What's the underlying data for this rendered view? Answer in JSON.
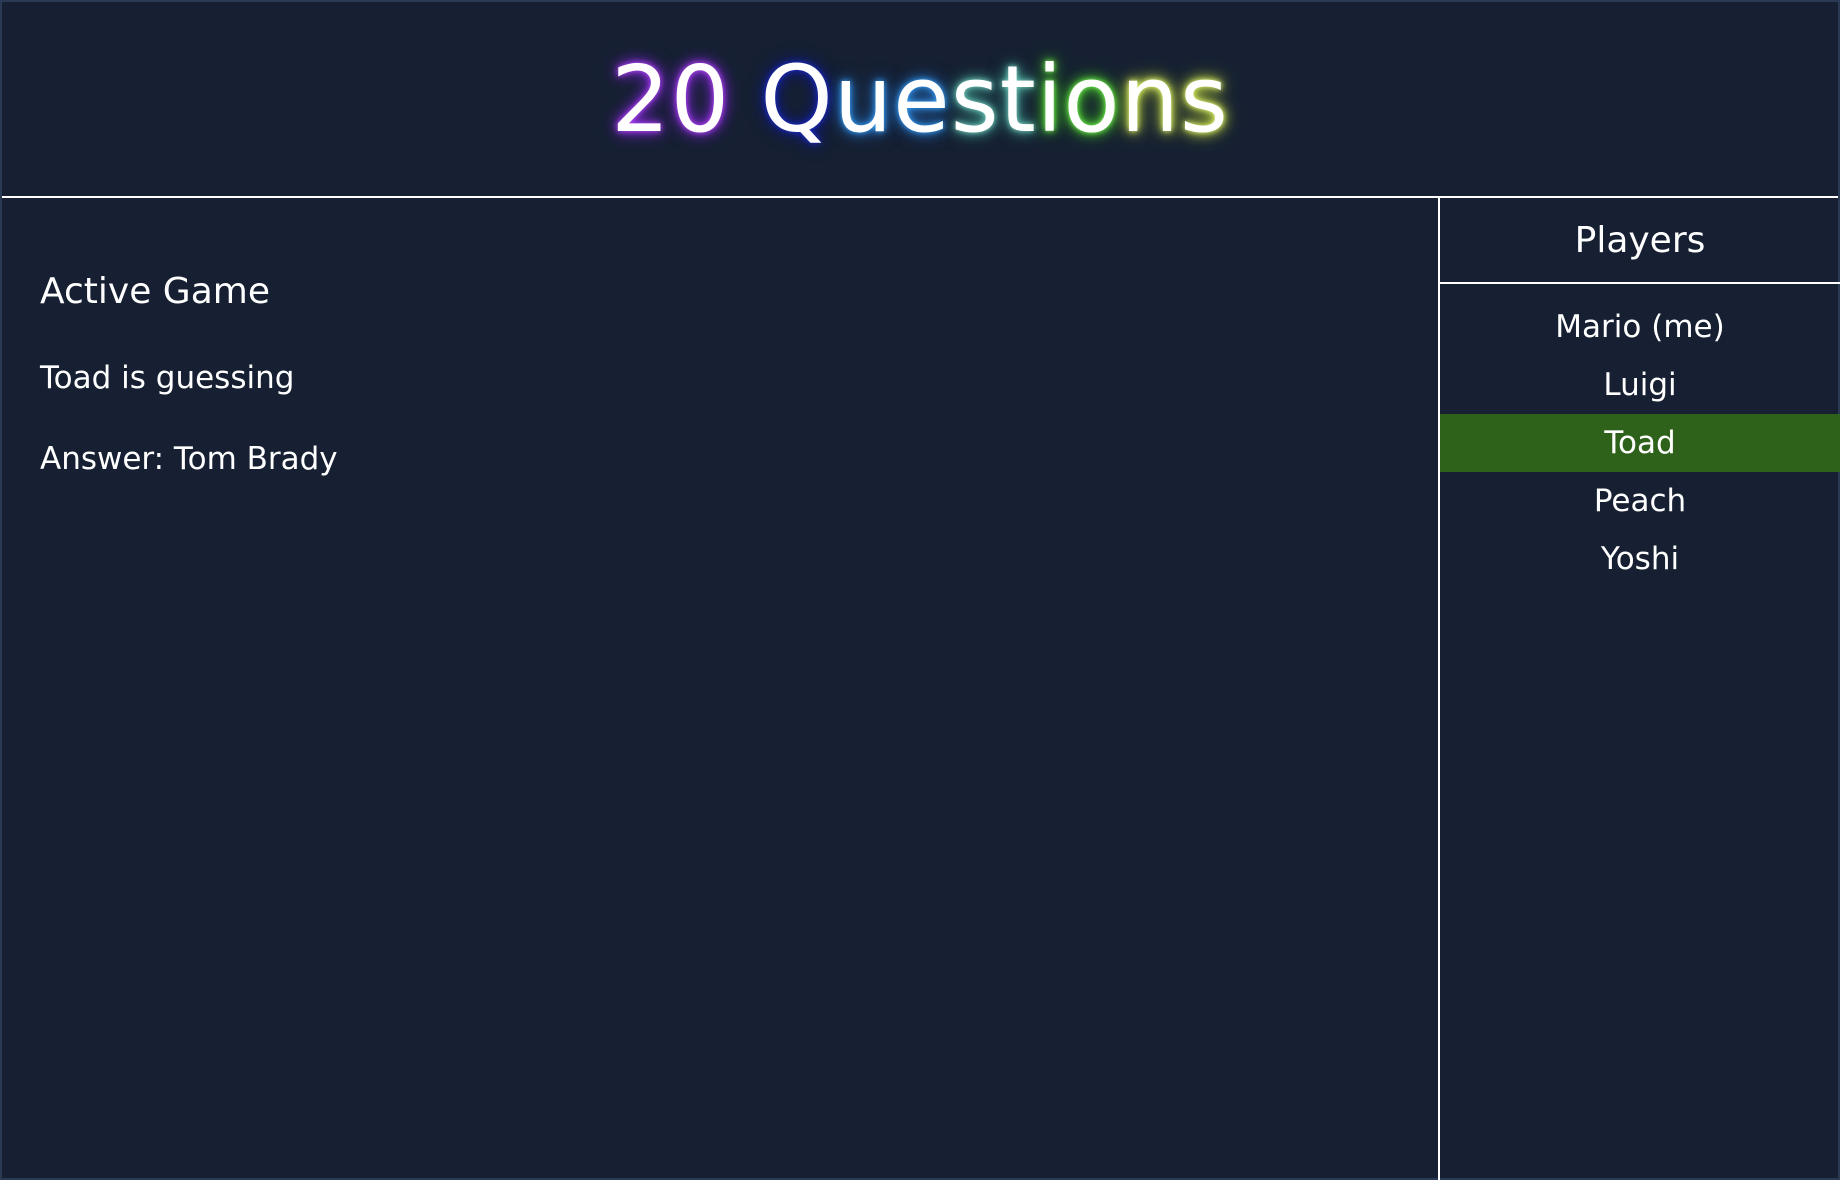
{
  "header": {
    "title_parts": [
      "20",
      " ",
      "Q",
      "ue",
      "st",
      "io",
      "ns"
    ]
  },
  "game": {
    "heading": "Active Game",
    "status": "Toad is guessing",
    "answer": "Answer: Tom Brady"
  },
  "players": {
    "heading": "Players",
    "items": [
      {
        "label": "Mario (me)",
        "active": false
      },
      {
        "label": "Luigi",
        "active": false
      },
      {
        "label": "Toad",
        "active": true
      },
      {
        "label": "Peach",
        "active": false
      },
      {
        "label": "Yoshi",
        "active": false
      }
    ],
    "active_color": "#2e621b"
  },
  "colors": {
    "background": "#162032",
    "text": "#ffffff",
    "divider": "#ffffff"
  }
}
